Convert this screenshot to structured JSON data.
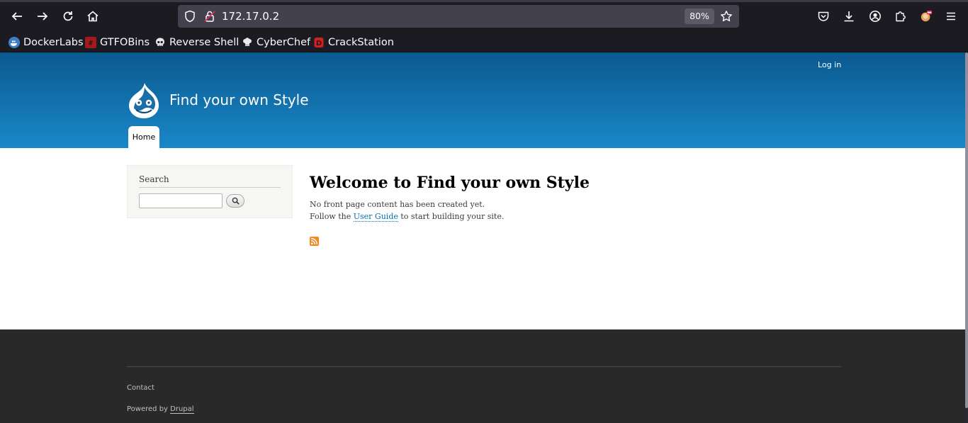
{
  "browser": {
    "url": "172.17.0.2",
    "zoom": "80%",
    "bookmarks": [
      {
        "label": "DockerLabs",
        "icon": "docker-whale-icon"
      },
      {
        "label": "GTFOBins",
        "icon": "gtfobins-icon"
      },
      {
        "label": "Reverse Shell",
        "icon": "skull-icon"
      },
      {
        "label": "CyberChef",
        "icon": "chef-hat-icon"
      },
      {
        "label": "CrackStation",
        "icon": "crackstation-icon"
      }
    ]
  },
  "site": {
    "name": "Find your own Style",
    "login_label": "Log in",
    "nav": {
      "home": "Home"
    },
    "header_colors": [
      "#0a5a8f",
      "#1a87c8"
    ]
  },
  "sidebar": {
    "search_title": "Search",
    "search_value": ""
  },
  "main": {
    "title": "Welcome to Find your own Style",
    "line1": "No front page content has been created yet.",
    "line2_before": "Follow the",
    "line2_link": "User Guide",
    "line2_after": "to start building your site."
  },
  "footer": {
    "contact": "Contact",
    "powered_by": "Powered by",
    "drupal": "Drupal"
  }
}
